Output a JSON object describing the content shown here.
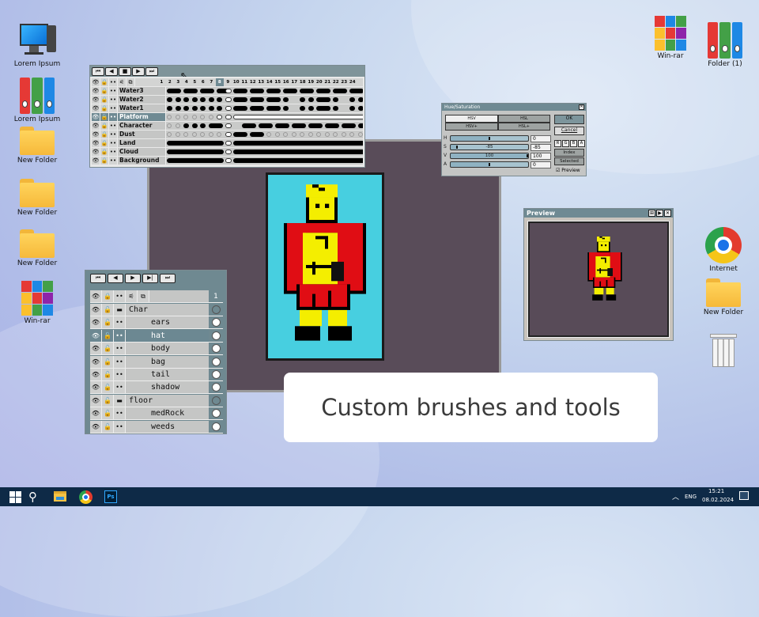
{
  "desktop": {
    "left_icons": [
      {
        "label": "Lorem Ipsum",
        "icon": "computer-icon"
      },
      {
        "label": "Lorem Ipsum",
        "icon": "binders-icon"
      },
      {
        "label": "New Folder",
        "icon": "folder-icon"
      },
      {
        "label": "New Folder",
        "icon": "folder-icon"
      },
      {
        "label": "New Folder",
        "icon": "folder-icon"
      },
      {
        "label": "Win-rar",
        "icon": "winrar-icon"
      }
    ],
    "right_icons": [
      {
        "label": "Win-rar",
        "icon": "winrar-icon"
      },
      {
        "label": "Folder (1)",
        "icon": "binders-icon"
      },
      {
        "label": "Internet",
        "icon": "chrome-icon"
      },
      {
        "label": "New Folder",
        "icon": "folder-icon"
      },
      {
        "label": "",
        "icon": "recycle-bin-icon"
      }
    ]
  },
  "timeline": {
    "frames": [
      "1",
      "2",
      "3",
      "4",
      "5",
      "6",
      "7",
      "8",
      "9",
      "10",
      "11",
      "12",
      "13",
      "14",
      "15",
      "16",
      "17",
      "18",
      "19",
      "20",
      "21",
      "22",
      "23",
      "24"
    ],
    "current_frame": 8,
    "layers": [
      "Water3",
      "Water2",
      "Water1",
      "Platform",
      "Character",
      "Dust",
      "Land",
      "Cloud",
      "Background"
    ],
    "selected_layer": "Platform"
  },
  "hue_saturation": {
    "title": "Hue/Saturation",
    "modes": [
      "HSV",
      "HSL",
      "HSV+",
      "HSL+"
    ],
    "ok": "OK",
    "cancel": "Cancel",
    "channels": [
      {
        "label": "H",
        "value": "0",
        "fraction": 0.5
      },
      {
        "label": "S",
        "value": "-85",
        "fraction": 0.07
      },
      {
        "label": "V",
        "value": "100",
        "fraction": 1.0
      },
      {
        "label": "A",
        "value": "0",
        "fraction": 0.5
      }
    ],
    "rgba": [
      "R",
      "G",
      "B",
      "A"
    ],
    "index": "Index",
    "selected": "Selected",
    "preview": "Preview",
    "preview_checked": true
  },
  "preview_window": {
    "title": "Preview"
  },
  "layers_panel": {
    "header_number": "1",
    "rows": [
      {
        "name": "Char",
        "type": "folder",
        "indent": 0
      },
      {
        "name": "ears",
        "type": "layer",
        "indent": 1
      },
      {
        "name": "hat",
        "type": "layer",
        "indent": 1,
        "selected": true
      },
      {
        "name": "body",
        "type": "layer",
        "indent": 1
      },
      {
        "name": "bag",
        "type": "layer",
        "indent": 1
      },
      {
        "name": "tail",
        "type": "layer",
        "indent": 1
      },
      {
        "name": "shadow",
        "type": "layer",
        "indent": 1
      },
      {
        "name": "floor",
        "type": "folder",
        "indent": 0
      },
      {
        "name": "medRock",
        "type": "layer",
        "indent": 1
      },
      {
        "name": "weeds",
        "type": "layer",
        "indent": 1
      }
    ]
  },
  "caption": "Custom brushes and tools",
  "taskbar": {
    "language": "ENG",
    "time": "15:21",
    "date": "08.02.2024"
  },
  "colors": {
    "taskbar": "#0e2a47",
    "canvas_bg": "#47cfe0",
    "workspace": "#584b58",
    "panel": "#6f8991"
  }
}
